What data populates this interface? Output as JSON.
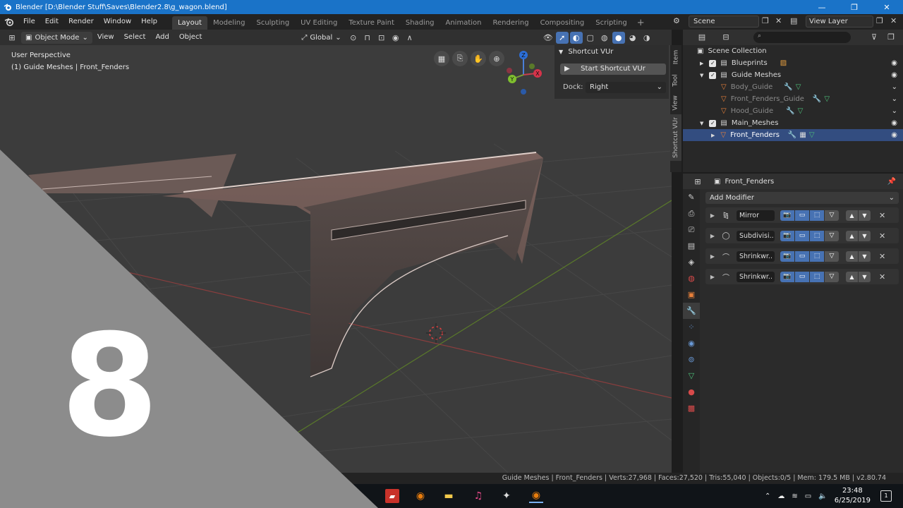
{
  "titlebar": {
    "title": "Blender [D:\\Blender Stuff\\Saves\\Blender2.8\\g_wagon.blend]",
    "minimize": "—",
    "maximize": "❐",
    "close": "✕"
  },
  "menus": [
    "File",
    "Edit",
    "Render",
    "Window",
    "Help"
  ],
  "workspaces": [
    "Layout",
    "Modeling",
    "Sculpting",
    "UV Editing",
    "Texture Paint",
    "Shading",
    "Animation",
    "Rendering",
    "Compositing",
    "Scripting"
  ],
  "workspace_active": "Layout",
  "workspace_add": "+",
  "scene": {
    "name": "Scene",
    "view_layer": "View Layer"
  },
  "viewport_header": {
    "mode": "Object Mode",
    "menus": [
      "View",
      "Select",
      "Add",
      "Object"
    ],
    "transform_orientation": "Global"
  },
  "viewport": {
    "perspective": "User Perspective",
    "active_object": "(1) Guide Meshes | Front_Fenders",
    "gizmo_axes": {
      "x": "X",
      "y": "Y",
      "z": "Z"
    }
  },
  "npanel": {
    "title": "Shortcut VUr",
    "button": "Start Shortcut VUr",
    "dock_label": "Dock:",
    "dock_value": "Right",
    "tabs": [
      "Item",
      "Tool",
      "View",
      "Shortcut VUr"
    ],
    "active_tab": "Shortcut VUr"
  },
  "outliner": {
    "rows": [
      {
        "name": "Scene Collection",
        "type": "scene-collection"
      },
      {
        "name": "Blueprints",
        "type": "collection"
      },
      {
        "name": "Guide Meshes",
        "type": "collection"
      },
      {
        "name": "Body_Guide",
        "type": "object"
      },
      {
        "name": "Front_Fenders_Guide",
        "type": "object"
      },
      {
        "name": "Hood_Guide",
        "type": "object"
      },
      {
        "name": "Main_Meshes",
        "type": "collection"
      },
      {
        "name": "Front_Fenders",
        "type": "object",
        "selected": true
      }
    ]
  },
  "properties": {
    "object_name": "Front_Fenders",
    "add_modifier": "Add Modifier",
    "modifiers": [
      "Mirror",
      "Subdivisi..",
      "Shrinkwr..",
      "Shrinkwr.."
    ]
  },
  "statusbar": {
    "text": "Guide Meshes | Front_Fenders | Verts:27,968 | Faces:27,520 | Tris:55,040 | Objects:0/5 | Mem: 179.5 MB | v2.80.74"
  },
  "taskbar": {
    "time": "23:48",
    "date": "6/25/2019",
    "notification_count": "1"
  },
  "overlay": {
    "number": "8"
  },
  "colors": {
    "accent": "#4772b3",
    "titlebar": "#1a73c8",
    "selected_row": "#334d80"
  }
}
